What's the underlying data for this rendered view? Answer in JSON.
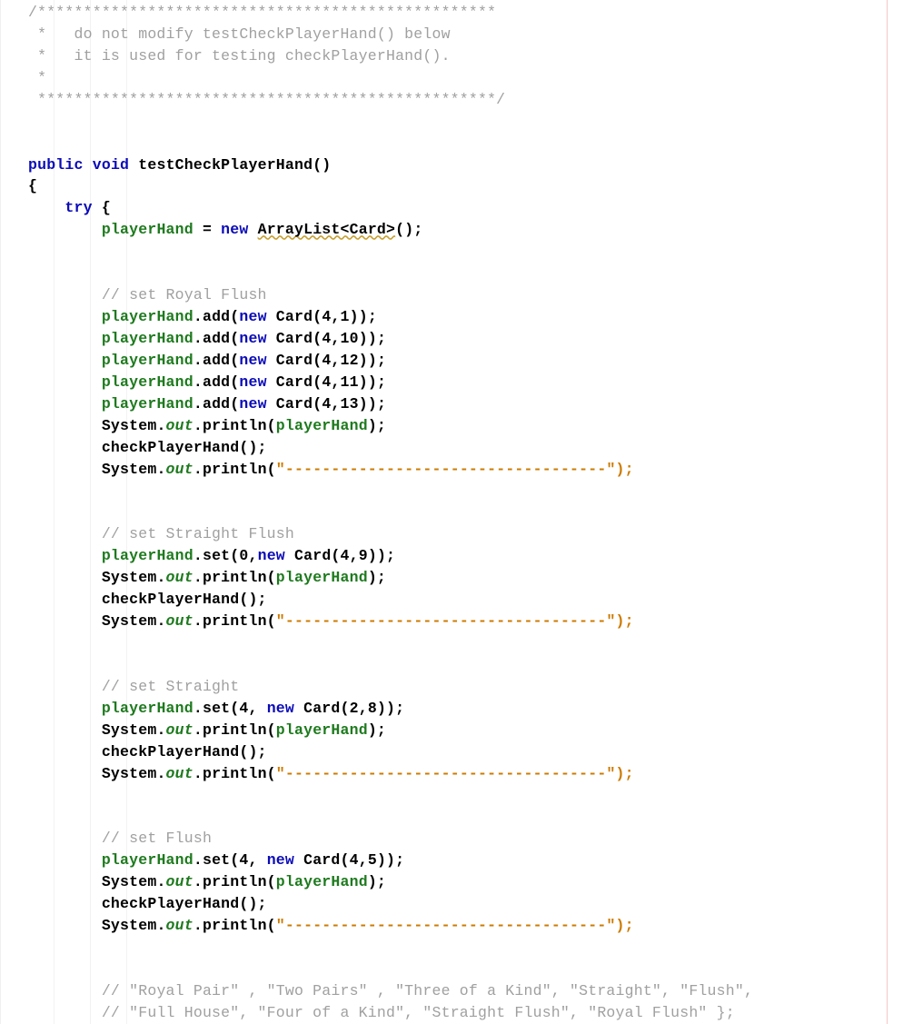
{
  "code": {
    "c_block_open": "/**************************************************",
    "c_block_l1": " *   do not modify testCheckPlayerHand() below",
    "c_block_l2": " *   it is used for testing checkPlayerHand().",
    "c_block_l3": " *",
    "c_block_close": " **************************************************/",
    "kw_public": "public",
    "kw_void": "void",
    "method": "testCheckPlayerHand",
    "paren": "()",
    "brace_open": "{",
    "kw_try": "try",
    "try_brace": " {",
    "id_playerHand": "playerHand",
    "op_eq": " = ",
    "kw_new": "new",
    "ty_arraylist": "ArrayList<Card>",
    "tail_new": "();",
    "c_royal": "// set Royal Flush",
    "add_open": ".add(",
    "call_card": " Card(",
    "args_41": "4,1",
    "args_410": "4,10",
    "args_412": "4,12",
    "args_411": "4,11",
    "args_413": "4,13",
    "call_close": "));",
    "sys": "System.",
    "out": "out",
    "println_open": ".println(",
    "println_close_id": ");",
    "check_call": "checkPlayerHand();",
    "dash_str_open": "\"",
    "dash_body": "-----------------------------------",
    "dash_str_close": "\");",
    "c_sflush": "// set Straight Flush",
    "set_open": ".set(",
    "set0_args": "0,",
    "args_49": "4,9",
    "c_straight": "// set Straight",
    "set4_args": "4, ",
    "args_28": "2,8",
    "c_flush": "// set Flush",
    "args_45": "4,5",
    "c_list1": "// \"Royal Pair\" , \"Two Pairs\" , \"Three of a Kind\", \"Straight\", \"Flush\",",
    "c_list2": "// \"Full House\", \"Four of a Kind\", \"Straight Flush\", \"Royal Flush\" };"
  }
}
